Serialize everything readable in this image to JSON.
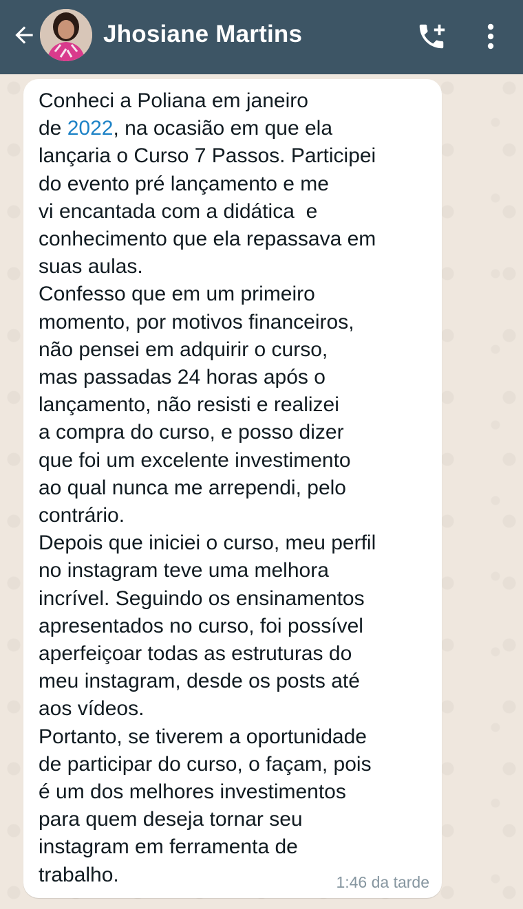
{
  "header": {
    "contact_name": "Jhosiane Martins",
    "background_color": "#3D5565",
    "icons": [
      "back-arrow-icon",
      "avatar",
      "add-call-icon",
      "more-vert-icon"
    ]
  },
  "message": {
    "lines": [
      "Conheci a Poliana em janeiro",
      "",
      "lançaria o Curso 7 Passos. Participei",
      "do evento pré lançamento e me",
      "vi encantada com a didática  e",
      "conhecimento que ela repassava em",
      "suas aulas.",
      "Confesso que em um primeiro",
      "momento, por motivos financeiros,",
      "não pensei em adquirir o curso,",
      "mas passadas 24 horas após o",
      "lançamento, não resisti e realizei",
      "a compra do curso, e posso dizer",
      "que foi um excelente investimento",
      "ao qual nunca me arrependi, pelo",
      "contrário.",
      "Depois que iniciei o curso, meu perfil",
      "no instagram teve uma melhora",
      "incrível. Seguindo os ensinamentos",
      "apresentados no curso, foi possível",
      "aperfeiçoar todas as estruturas do",
      "meu instagram, desde os posts até",
      "aos vídeos.",
      "Portanto, se tiverem a oportunidade",
      "de participar do curso, o façam, pois",
      "é um dos melhores investimentos",
      "para quem deseja tornar seu",
      "instagram em ferramenta de",
      "trabalho."
    ],
    "line2_prefix": "de ",
    "line2_link": "2022",
    "line2_suffix": ", na ocasião em que ela",
    "link_color": "#1D82C6",
    "timestamp": "1:46 da tarde"
  }
}
